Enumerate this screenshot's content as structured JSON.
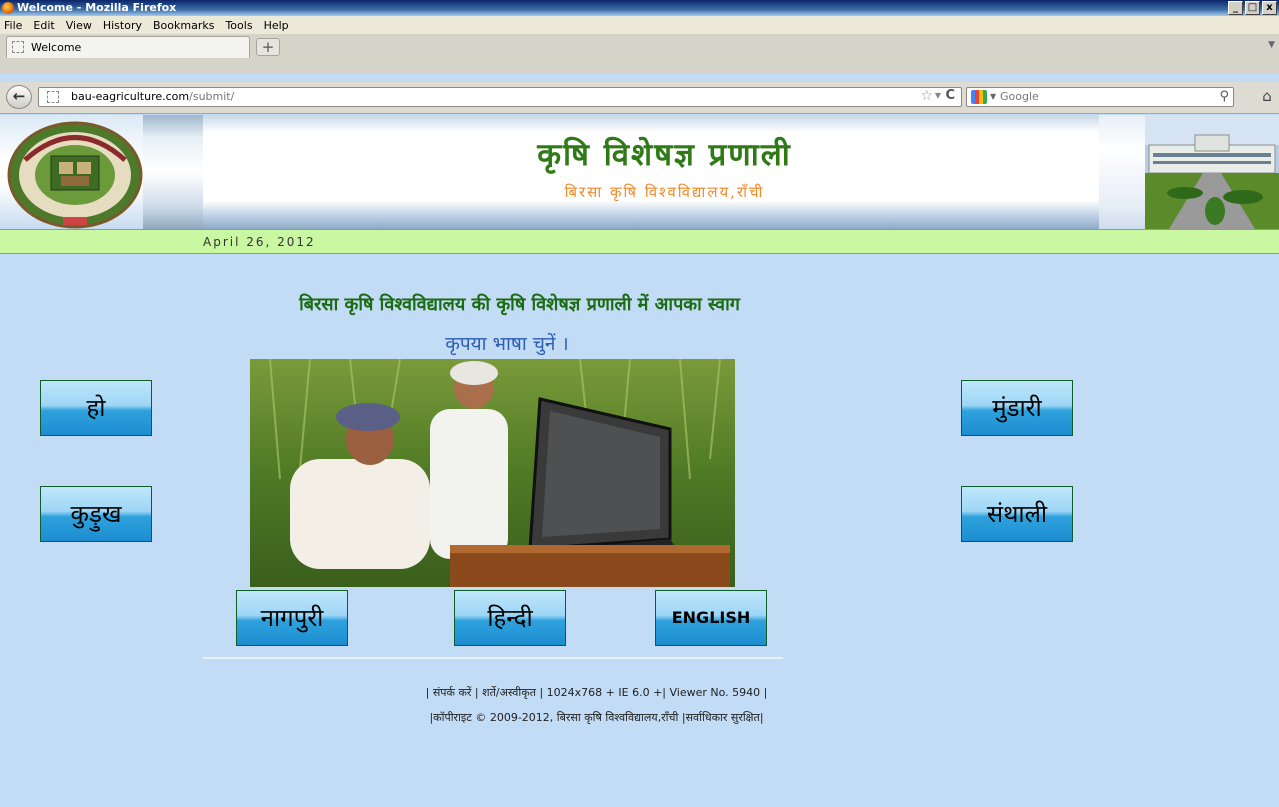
{
  "window": {
    "title": "Welcome - Mozilla Firefox",
    "controls": [
      "_",
      "□",
      "x"
    ]
  },
  "menu": [
    "File",
    "Edit",
    "View",
    "History",
    "Bookmarks",
    "Tools",
    "Help"
  ],
  "tab": {
    "label": "Welcome",
    "new_tab_label": "+"
  },
  "urlbar": {
    "host": "bau-eagriculture.com",
    "path": "/submit/"
  },
  "searchbar": {
    "engine": "Google"
  },
  "header": {
    "title": "कृषि  विशेषज्ञ  प्रणाली",
    "subtitle": "बिरसा कृषि विश्वविद्यालय,राँची"
  },
  "date": "April 26, 2012",
  "welcome_text": "बिरसा कृषि विश्वविद्यालय की कृषि विशेषज्ञ प्रणाली में आपका स्वाग",
  "choose_language_text": "कृपया भाषा चुनें ।",
  "languages": {
    "ho": "हो",
    "kurukh": "कुड़ुख",
    "mundari": "मुंडारी",
    "santhali": "संथाली",
    "nagpuri": "नागपुरी",
    "hindi": "हिन्दी",
    "english": "ENGLISH"
  },
  "footer": {
    "contact": "संपर्क करें",
    "terms": "शर्ते/अस्वीकृत",
    "resolution": "1024x768 + IE 6.0 +",
    "viewer": "Viewer No. 5940",
    "copyright": "|कॉपीराइट © 2009-2012, बिरसा कृषि विश्वविद्यालय,राँची |सर्वाधिकार सुरक्षित|"
  },
  "colors": {
    "page_bg": "#c2dcf5",
    "title_green": "#2f7a16",
    "subtitle_orange": "#f08a2a",
    "date_bar": "#c9f7a2",
    "choose_blue": "#2d5cb4"
  }
}
